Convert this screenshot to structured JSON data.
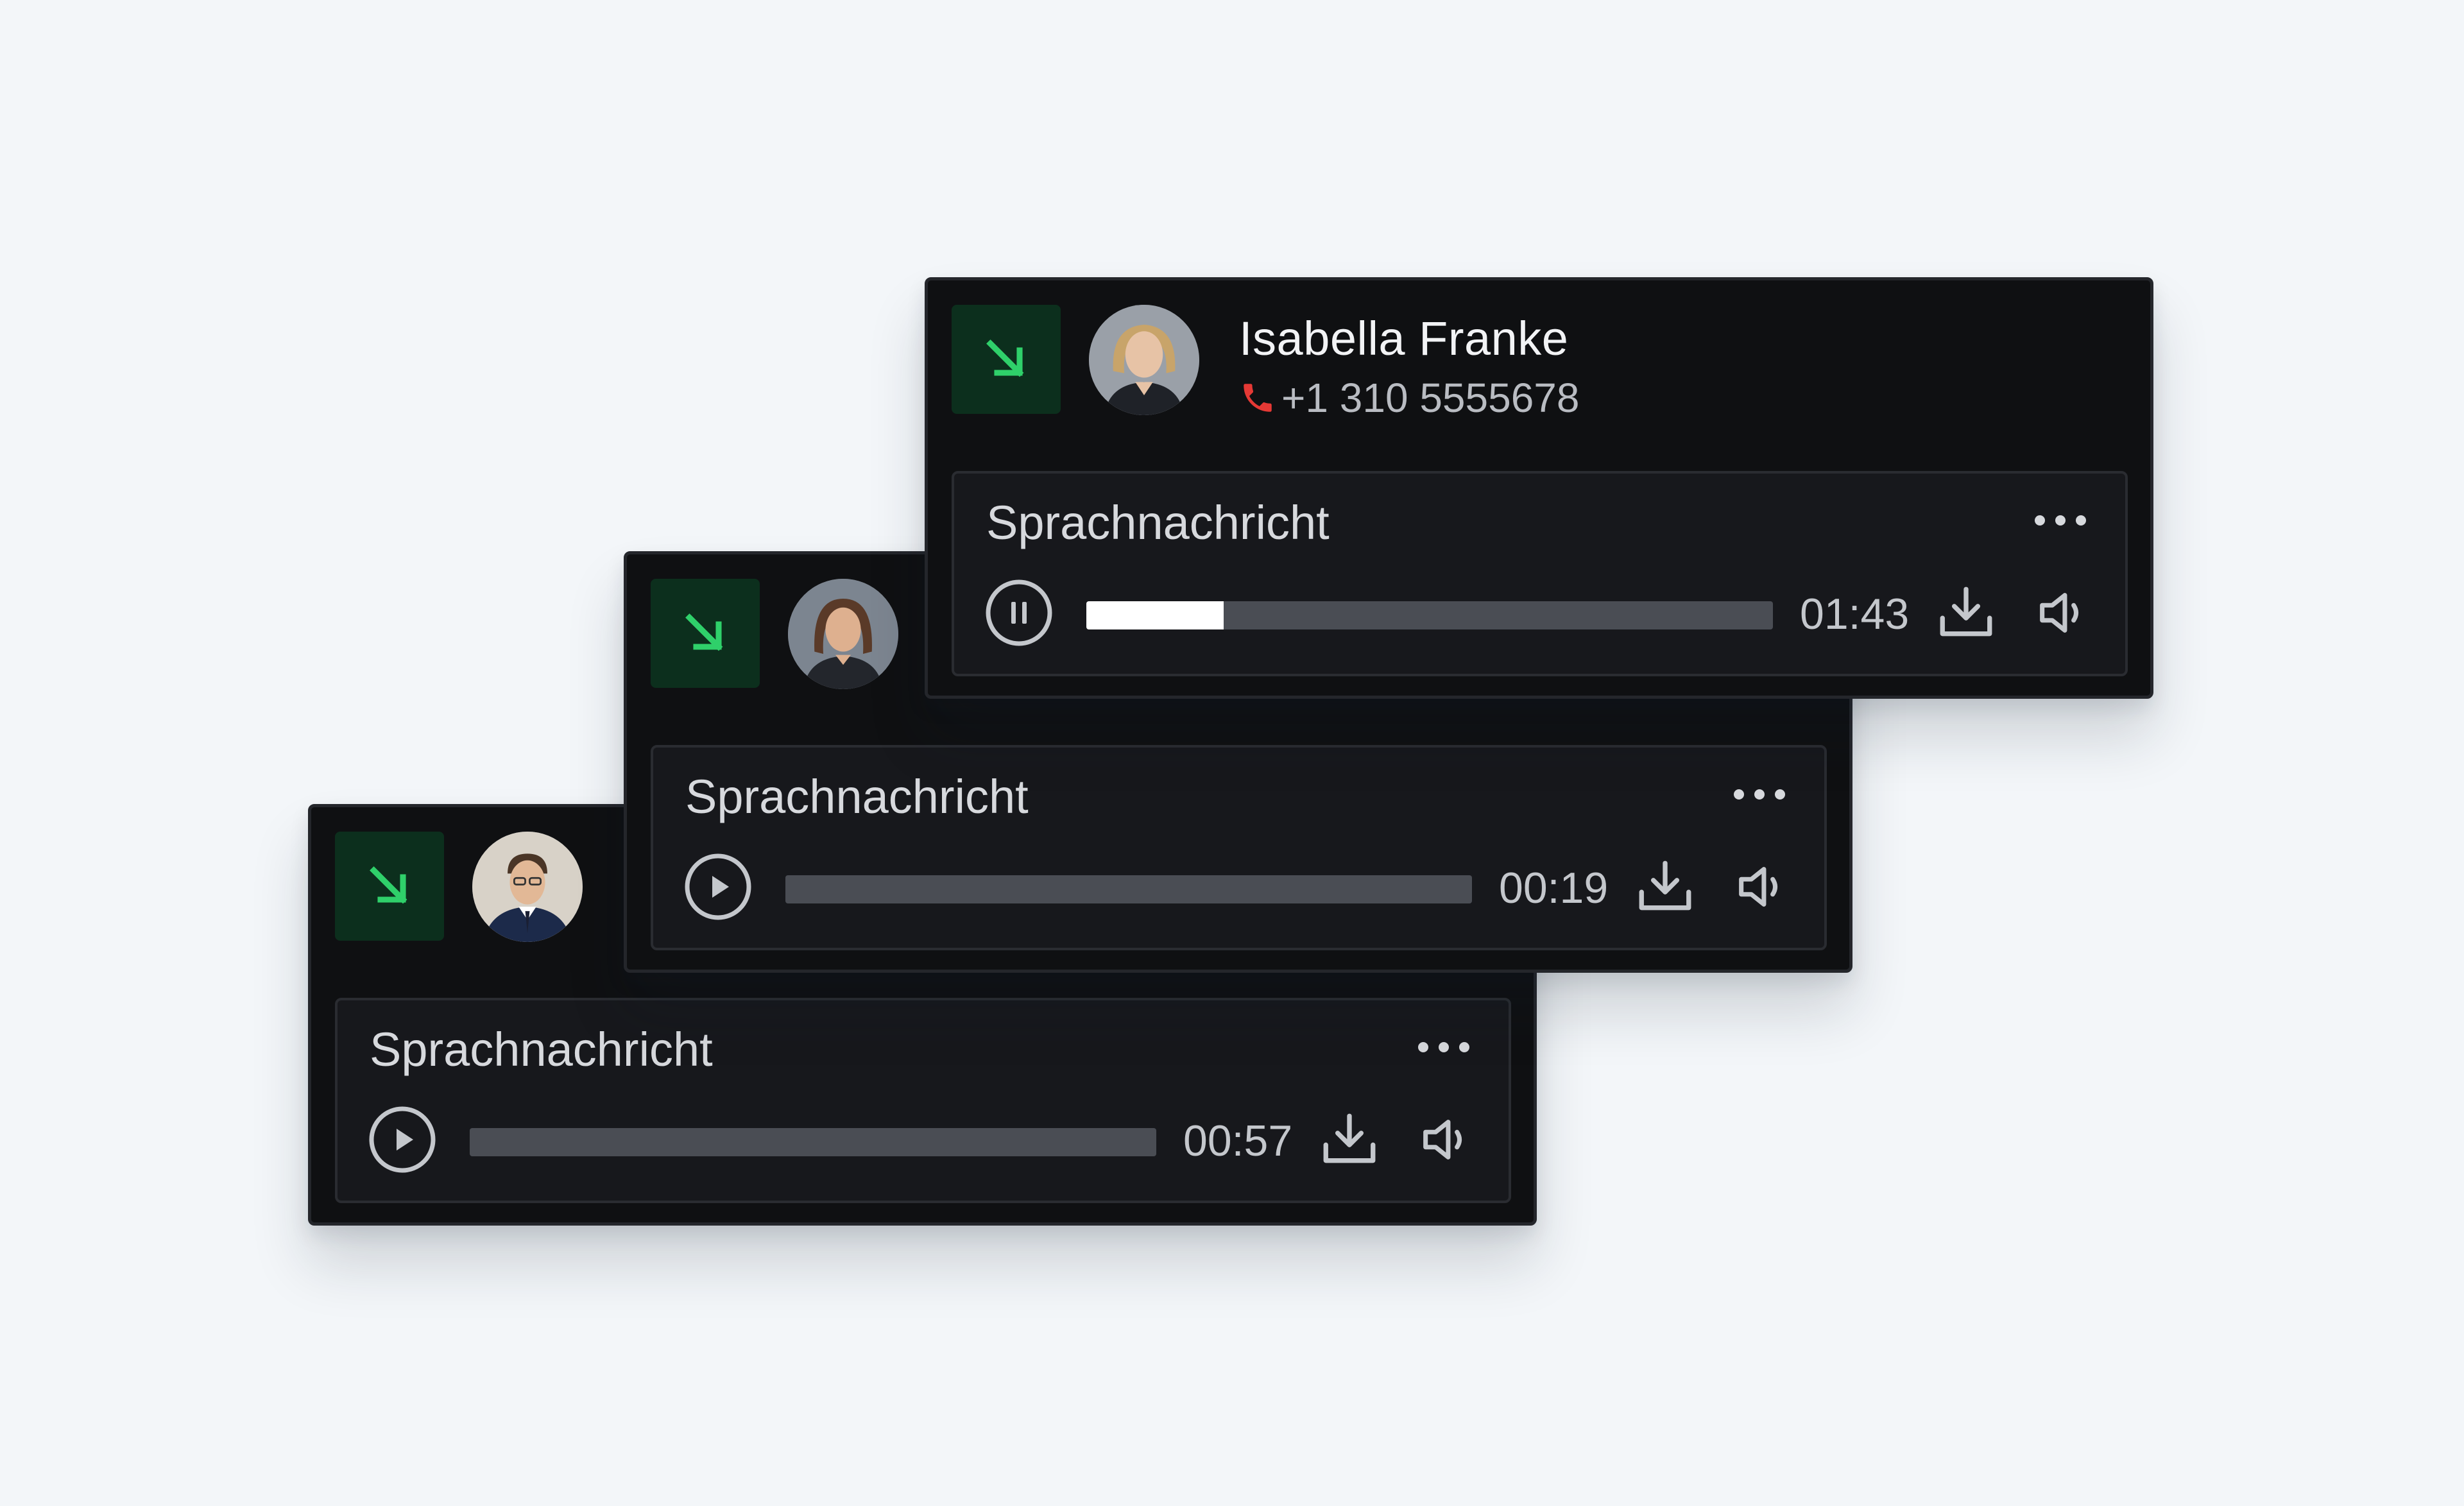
{
  "colors": {
    "background": "#f3f6f9",
    "card": "#0f1012",
    "message_box": "#17181c",
    "call_badge_bg": "#0c2f1d",
    "call_arrow": "#2fd06a",
    "phone_icon": "#e53935",
    "track": "#4a4d54",
    "fill": "#ffffff"
  },
  "cards": [
    {
      "call_icon": "incoming-call-arrow-icon",
      "contact": {
        "name": "Isabella Franke",
        "phone": "+1 310 5555678"
      },
      "message": {
        "title": "Sprachnachricht",
        "state": "pause",
        "progress": 0.2,
        "time": "01:43"
      }
    },
    {
      "call_icon": "incoming-call-arrow-icon",
      "message": {
        "title": "Sprachnachricht",
        "state": "play",
        "progress": 0,
        "time": "00:19"
      }
    },
    {
      "call_icon": "incoming-call-arrow-icon",
      "message": {
        "title": "Sprachnachricht",
        "state": "play",
        "progress": 0,
        "time": "00:57"
      }
    }
  ]
}
